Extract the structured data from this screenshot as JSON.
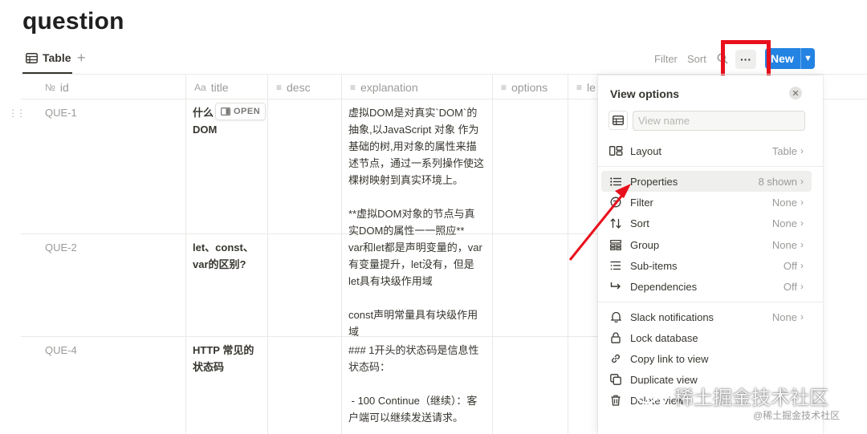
{
  "page": {
    "title": "question"
  },
  "toolbar": {
    "tab_label": "Table",
    "add_view": "+",
    "filter_label": "Filter",
    "sort_label": "Sort",
    "more_label": "···",
    "new_label": "New"
  },
  "columns": [
    {
      "icon": "№",
      "label": "id"
    },
    {
      "icon": "Aa",
      "label": "title"
    },
    {
      "icon": "≡",
      "label": "desc"
    },
    {
      "icon": "≡",
      "label": "explanation"
    },
    {
      "icon": "≡",
      "label": "options"
    },
    {
      "icon": "≡",
      "label": "le"
    }
  ],
  "rows": [
    {
      "id": "QUE-1",
      "title": "什么是虚拟DOM",
      "title_shown": "什么\nDOM",
      "desc": "",
      "explanation": "虚拟DOM是对真实`DOM`的\n抽象,以JavaScript 对象 作为\n基础的树,用对象的属性来描\n述节点，通过一系列操作使这\n棵树映射到真实环境上。\n\n**虚拟DOM对象的节点与真\n实DOM的属性一一照应**"
    },
    {
      "id": "QUE-2",
      "title": "let、const、\nvar的区别?",
      "desc": "",
      "explanation": "var和let都是声明变量的，var\n有变量提升，let没有，但是\nlet具有块级作用域\n\nconst声明常量具有块级作用\n域"
    },
    {
      "id": "QUE-4",
      "title": "HTTP 常见的\n状态码",
      "desc": "",
      "explanation": "### 1开头的状态码是信息性\n状态码：\n\n - 100 Continue（继续）：客\n户端可以继续发送请求。"
    }
  ],
  "open_chip": "OPEN",
  "view_options": {
    "title": "View options",
    "view_name_placeholder": "View name",
    "items": [
      {
        "icon": "layout-icon",
        "label": "Layout",
        "value": "Table"
      },
      {
        "icon": "properties-icon",
        "label": "Properties",
        "value": "8 shown"
      },
      {
        "icon": "filter-icon",
        "label": "Filter",
        "value": "None"
      },
      {
        "icon": "sort-icon",
        "label": "Sort",
        "value": "None"
      },
      {
        "icon": "group-icon",
        "label": "Group",
        "value": "None"
      },
      {
        "icon": "sub-items-icon",
        "label": "Sub-items",
        "value": "Off"
      },
      {
        "icon": "dependencies-icon",
        "label": "Dependencies",
        "value": "Off"
      },
      {
        "icon": "bell-icon",
        "label": "Slack notifications",
        "value": "None"
      },
      {
        "icon": "lock-icon",
        "label": "Lock database",
        "value": ""
      },
      {
        "icon": "link-icon",
        "label": "Copy link to view",
        "value": ""
      },
      {
        "icon": "duplicate-icon",
        "label": "Duplicate view",
        "value": ""
      },
      {
        "icon": "trash-icon",
        "label": "Delete view",
        "value": ""
      }
    ]
  },
  "watermark": {
    "large": "稀土掘金技术社区",
    "small": "@稀土掘金技术社区"
  },
  "colors": {
    "accent": "#2383e2",
    "annotation": "#e8101c"
  }
}
